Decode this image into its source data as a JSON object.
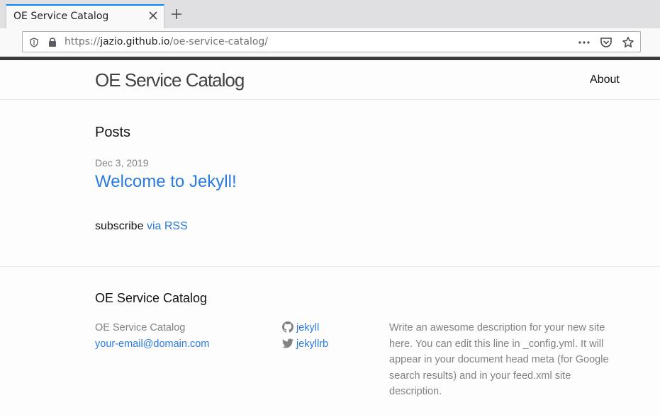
{
  "browser": {
    "tab_title": "OE Service Catalog",
    "url_scheme": "https://",
    "url_host": "jazio.github.io",
    "url_path": "/oe-service-catalog/",
    "accent": "#0a84ff"
  },
  "header": {
    "site_title": "OE Service Catalog",
    "nav": {
      "about": "About"
    }
  },
  "main": {
    "heading": "Posts",
    "posts": [
      {
        "date": "Dec 3, 2019",
        "title": "Welcome to Jekyll!"
      }
    ],
    "rss_prefix": "subscribe",
    "rss_link": "via RSS"
  },
  "footer": {
    "heading": "OE Service Catalog",
    "name": "OE Service Catalog",
    "email": "your-email@domain.com",
    "social": [
      {
        "icon": "github-icon",
        "label": "jekyll"
      },
      {
        "icon": "twitter-icon",
        "label": "jekyllrb"
      }
    ],
    "description": "Write an awesome description for your new site here. You can edit this line in _config.yml. It will appear in your document head meta (for Google search results) and in your feed.xml site description."
  },
  "colors": {
    "link": "#2a7ae2",
    "muted": "#828282",
    "text": "#111111"
  }
}
